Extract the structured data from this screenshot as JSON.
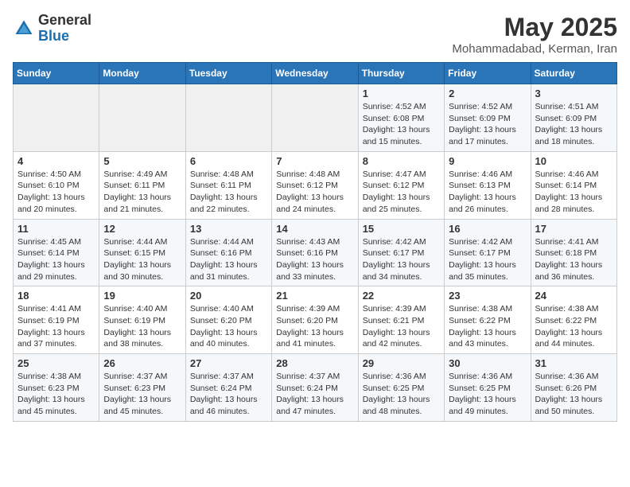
{
  "header": {
    "logo_general": "General",
    "logo_blue": "Blue",
    "month_year": "May 2025",
    "location": "Mohammadabad, Kerman, Iran"
  },
  "weekdays": [
    "Sunday",
    "Monday",
    "Tuesday",
    "Wednesday",
    "Thursday",
    "Friday",
    "Saturday"
  ],
  "weeks": [
    [
      {
        "day": "",
        "info": ""
      },
      {
        "day": "",
        "info": ""
      },
      {
        "day": "",
        "info": ""
      },
      {
        "day": "",
        "info": ""
      },
      {
        "day": "1",
        "info": "Sunrise: 4:52 AM\nSunset: 6:08 PM\nDaylight: 13 hours\nand 15 minutes."
      },
      {
        "day": "2",
        "info": "Sunrise: 4:52 AM\nSunset: 6:09 PM\nDaylight: 13 hours\nand 17 minutes."
      },
      {
        "day": "3",
        "info": "Sunrise: 4:51 AM\nSunset: 6:09 PM\nDaylight: 13 hours\nand 18 minutes."
      }
    ],
    [
      {
        "day": "4",
        "info": "Sunrise: 4:50 AM\nSunset: 6:10 PM\nDaylight: 13 hours\nand 20 minutes."
      },
      {
        "day": "5",
        "info": "Sunrise: 4:49 AM\nSunset: 6:11 PM\nDaylight: 13 hours\nand 21 minutes."
      },
      {
        "day": "6",
        "info": "Sunrise: 4:48 AM\nSunset: 6:11 PM\nDaylight: 13 hours\nand 22 minutes."
      },
      {
        "day": "7",
        "info": "Sunrise: 4:48 AM\nSunset: 6:12 PM\nDaylight: 13 hours\nand 24 minutes."
      },
      {
        "day": "8",
        "info": "Sunrise: 4:47 AM\nSunset: 6:12 PM\nDaylight: 13 hours\nand 25 minutes."
      },
      {
        "day": "9",
        "info": "Sunrise: 4:46 AM\nSunset: 6:13 PM\nDaylight: 13 hours\nand 26 minutes."
      },
      {
        "day": "10",
        "info": "Sunrise: 4:46 AM\nSunset: 6:14 PM\nDaylight: 13 hours\nand 28 minutes."
      }
    ],
    [
      {
        "day": "11",
        "info": "Sunrise: 4:45 AM\nSunset: 6:14 PM\nDaylight: 13 hours\nand 29 minutes."
      },
      {
        "day": "12",
        "info": "Sunrise: 4:44 AM\nSunset: 6:15 PM\nDaylight: 13 hours\nand 30 minutes."
      },
      {
        "day": "13",
        "info": "Sunrise: 4:44 AM\nSunset: 6:16 PM\nDaylight: 13 hours\nand 31 minutes."
      },
      {
        "day": "14",
        "info": "Sunrise: 4:43 AM\nSunset: 6:16 PM\nDaylight: 13 hours\nand 33 minutes."
      },
      {
        "day": "15",
        "info": "Sunrise: 4:42 AM\nSunset: 6:17 PM\nDaylight: 13 hours\nand 34 minutes."
      },
      {
        "day": "16",
        "info": "Sunrise: 4:42 AM\nSunset: 6:17 PM\nDaylight: 13 hours\nand 35 minutes."
      },
      {
        "day": "17",
        "info": "Sunrise: 4:41 AM\nSunset: 6:18 PM\nDaylight: 13 hours\nand 36 minutes."
      }
    ],
    [
      {
        "day": "18",
        "info": "Sunrise: 4:41 AM\nSunset: 6:19 PM\nDaylight: 13 hours\nand 37 minutes."
      },
      {
        "day": "19",
        "info": "Sunrise: 4:40 AM\nSunset: 6:19 PM\nDaylight: 13 hours\nand 38 minutes."
      },
      {
        "day": "20",
        "info": "Sunrise: 4:40 AM\nSunset: 6:20 PM\nDaylight: 13 hours\nand 40 minutes."
      },
      {
        "day": "21",
        "info": "Sunrise: 4:39 AM\nSunset: 6:20 PM\nDaylight: 13 hours\nand 41 minutes."
      },
      {
        "day": "22",
        "info": "Sunrise: 4:39 AM\nSunset: 6:21 PM\nDaylight: 13 hours\nand 42 minutes."
      },
      {
        "day": "23",
        "info": "Sunrise: 4:38 AM\nSunset: 6:22 PM\nDaylight: 13 hours\nand 43 minutes."
      },
      {
        "day": "24",
        "info": "Sunrise: 4:38 AM\nSunset: 6:22 PM\nDaylight: 13 hours\nand 44 minutes."
      }
    ],
    [
      {
        "day": "25",
        "info": "Sunrise: 4:38 AM\nSunset: 6:23 PM\nDaylight: 13 hours\nand 45 minutes."
      },
      {
        "day": "26",
        "info": "Sunrise: 4:37 AM\nSunset: 6:23 PM\nDaylight: 13 hours\nand 45 minutes."
      },
      {
        "day": "27",
        "info": "Sunrise: 4:37 AM\nSunset: 6:24 PM\nDaylight: 13 hours\nand 46 minutes."
      },
      {
        "day": "28",
        "info": "Sunrise: 4:37 AM\nSunset: 6:24 PM\nDaylight: 13 hours\nand 47 minutes."
      },
      {
        "day": "29",
        "info": "Sunrise: 4:36 AM\nSunset: 6:25 PM\nDaylight: 13 hours\nand 48 minutes."
      },
      {
        "day": "30",
        "info": "Sunrise: 4:36 AM\nSunset: 6:25 PM\nDaylight: 13 hours\nand 49 minutes."
      },
      {
        "day": "31",
        "info": "Sunrise: 4:36 AM\nSunset: 6:26 PM\nDaylight: 13 hours\nand 50 minutes."
      }
    ]
  ]
}
